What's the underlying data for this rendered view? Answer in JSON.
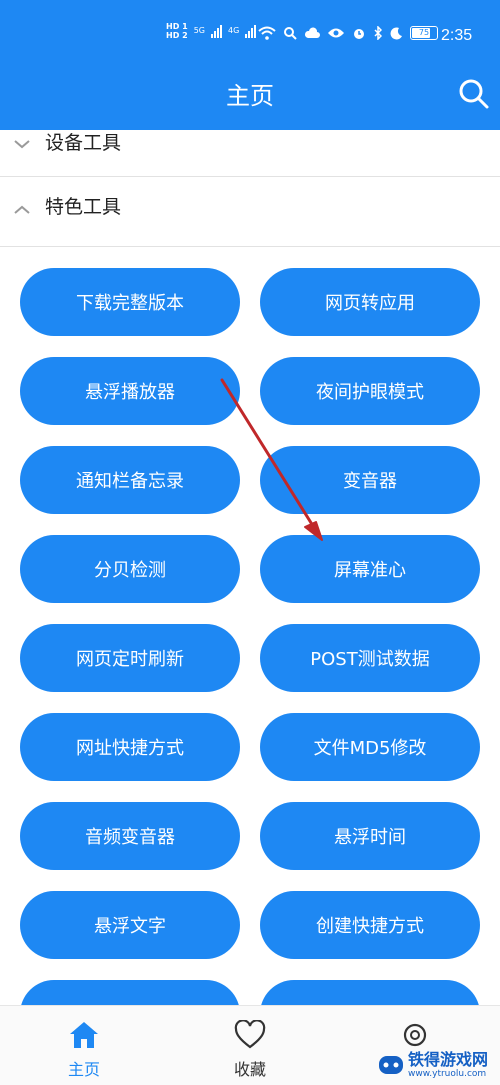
{
  "status_bar": {
    "hd1": "HD 1",
    "hd2": "HD 2",
    "sig1": "5G",
    "sig2": "4G",
    "battery": "75",
    "time": "2:35"
  },
  "header": {
    "title": "主页"
  },
  "sections": [
    {
      "label": "设备工具",
      "expanded": false
    },
    {
      "label": "特色工具",
      "expanded": true
    }
  ],
  "tools": [
    "下载完整版本",
    "网页转应用",
    "悬浮播放器",
    "夜间护眼模式",
    "通知栏备忘录",
    "变音器",
    "分贝检测",
    "屏幕准心",
    "网页定时刷新",
    "POST测试数据",
    "网址快捷方式",
    "文件MD5修改",
    "音频变音器",
    "悬浮时间",
    "悬浮文字",
    "创建快捷方式",
    "",
    ""
  ],
  "bottom_nav": [
    {
      "label": "主页",
      "icon": "home-icon",
      "active": true
    },
    {
      "label": "收藏",
      "icon": "heart-icon",
      "active": false
    }
  ],
  "watermark": {
    "name": "铁得游戏网",
    "url": "www.ytruolu.com"
  },
  "colors": {
    "primary": "#1e88f3",
    "arrow": "#c0282a",
    "text": "#222222"
  }
}
